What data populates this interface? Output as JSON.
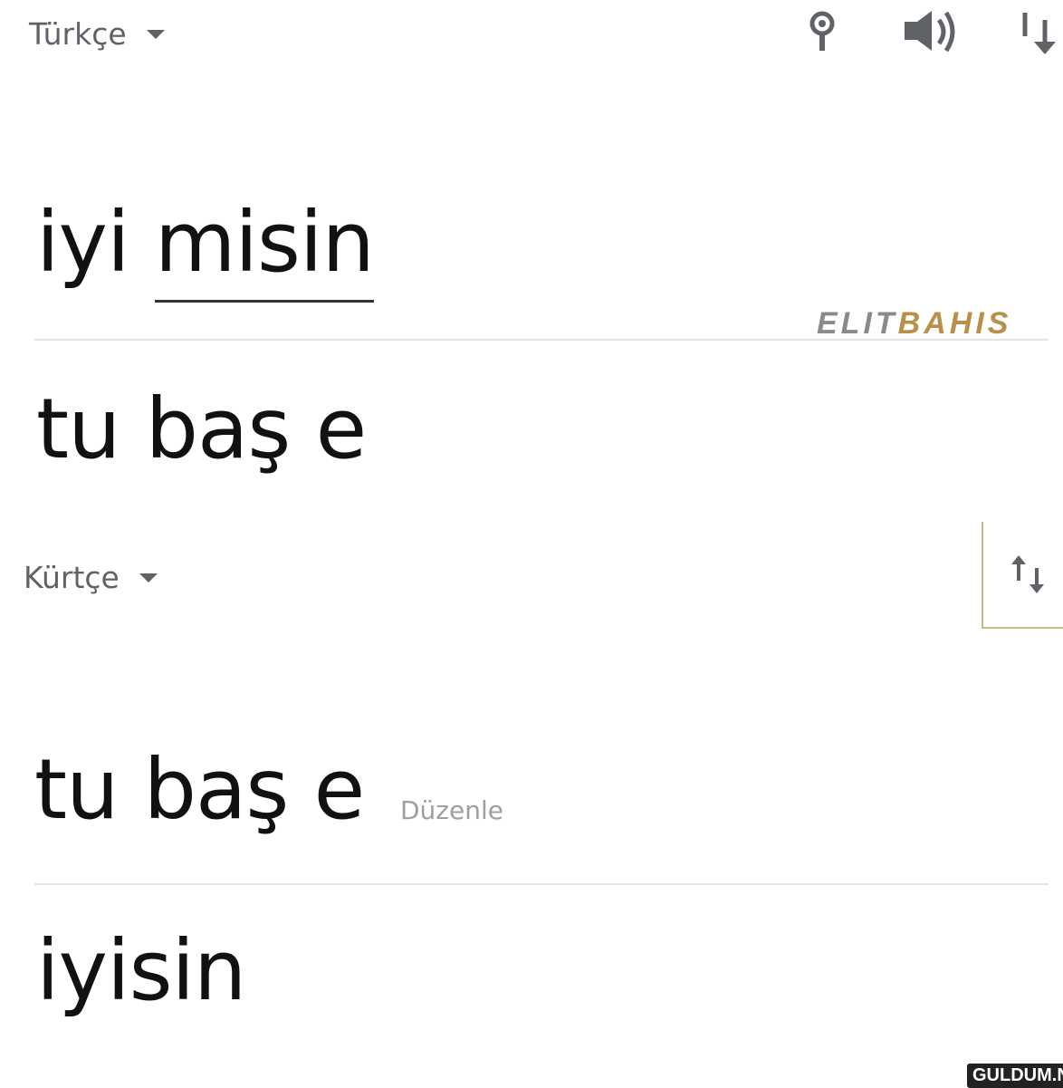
{
  "source": {
    "language_label": "Türkçe",
    "text_before": "iyi ",
    "text_underlined": "misin",
    "translation": "tu baş e"
  },
  "target": {
    "language_label": "Kürtçe",
    "text": "tu baş e",
    "edit_label": "Düzenle",
    "translation": "iyisin"
  },
  "toolbar": {
    "icons": [
      "microphone-icon",
      "speaker-icon",
      "swap-icon"
    ]
  },
  "watermarks": {
    "brand_part1": "ELIT",
    "brand_part2": "BAHIS",
    "site": "GULDUM.NET"
  },
  "colors": {
    "text": "#111111",
    "muted": "#5f6368",
    "divider": "#e3e3e3",
    "edit": "#9aa0a6",
    "brand_gold": "#b8904a"
  }
}
